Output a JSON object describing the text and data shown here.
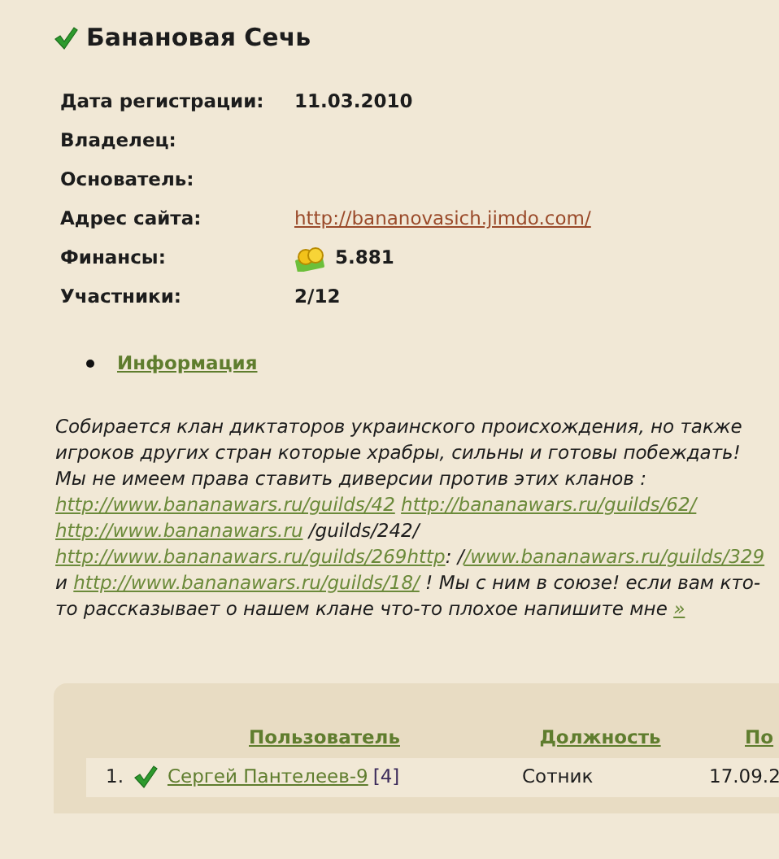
{
  "clan": {
    "title": "Банановая Сечь"
  },
  "info": [
    {
      "label": "Дата регистрации:",
      "value": "11.03.2010",
      "kind": "text"
    },
    {
      "label": "Владелец:"
    },
    {
      "label": "Основатель:"
    },
    {
      "label": "Адрес сайта:",
      "value": "http://bananovasich.jimdo.com/",
      "kind": "link"
    },
    {
      "label": "Финансы:",
      "value": "5.881",
      "kind": "money"
    },
    {
      "label": "Участники:",
      "value": "2/12",
      "kind": "text"
    }
  ],
  "section_link": "Информация",
  "description": [
    {
      "kind": "text",
      "text": "Собирается клан диктаторов украинского происхождения, но также игроков других стран которые храбры, сильны и готовы побеждать!Мы не имеем права ставить диверсии против этих кланов : "
    },
    {
      "kind": "link",
      "text": "http://www.bananawars.ru/guilds/42"
    },
    {
      "kind": "link",
      "text": "http://bananawars.ru/guilds/62/"
    },
    {
      "kind": "link",
      "text": "http://www.bananawars.ru"
    },
    {
      "kind": "text",
      "text": " /guilds/242/ "
    },
    {
      "kind": "link",
      "text": "http://www.bananawars.ru/guilds/269http"
    },
    {
      "kind": "text",
      "text": ": /"
    },
    {
      "kind": "link",
      "text": "/www.bananawars.ru/guilds/329"
    },
    {
      "kind": "text",
      "text": " и "
    },
    {
      "kind": "link",
      "text": "http://www.bananawars.ru/guilds/18/"
    },
    {
      "kind": "text",
      "text": " ! Мы с ним в союзе! если вам кто-то рассказывает о нашем клане что-то плохое напишите мне "
    },
    {
      "kind": "link",
      "text": "»"
    }
  ],
  "members": {
    "columns": [
      "Пользователь",
      "Должность",
      "По"
    ],
    "rows": [
      {
        "number": "1.",
        "name": "Сергей Пантелеев-9",
        "level": "[4]",
        "role": "Сотник",
        "date": "17.09.2"
      }
    ]
  }
}
